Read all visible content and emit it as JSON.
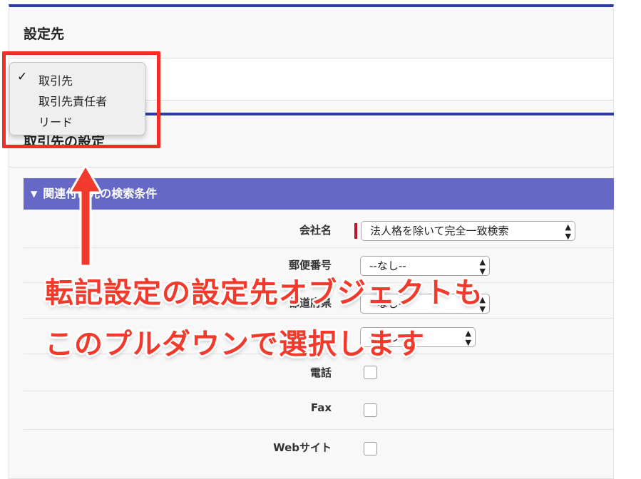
{
  "section1": {
    "title": "設定先"
  },
  "section2": {
    "title": "取引先の設定"
  },
  "dropdown": {
    "items": [
      {
        "label": "取引先",
        "selected": true
      },
      {
        "label": "取引先責任者",
        "selected": false
      },
      {
        "label": "リード",
        "selected": false
      }
    ]
  },
  "criteria": {
    "header": "関連付け先の検索条件",
    "fields": [
      {
        "label": "会社名",
        "value": "法人格を除いて完全一致検索"
      },
      {
        "label": "郵便番号",
        "value": "--なし--"
      },
      {
        "label": "都道府県",
        "value": "--なし--"
      },
      {
        "label": "",
        "value": "--なし--"
      },
      {
        "label": "電話"
      },
      {
        "label": "Fax"
      },
      {
        "label": "Webサイト"
      }
    ]
  },
  "annotation": {
    "line1": "転記設定の設定先オブジェクトも",
    "line2": "このプルダウンで選択します",
    "color": "#f23a2c"
  },
  "colors": {
    "accent_blue": "#2a3aa8",
    "section_header": "#6568c4",
    "required": "#c0102a"
  }
}
